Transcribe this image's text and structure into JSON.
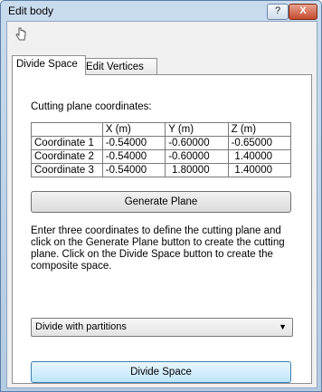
{
  "window": {
    "title": "Edit body",
    "help_label": "?",
    "close_label": "X"
  },
  "toolbar": {
    "icon": "cursor-hand-icon"
  },
  "tabs": [
    {
      "label": "Divide Space",
      "active": true
    },
    {
      "label": "Edit Vertices",
      "active": false
    }
  ],
  "panel": {
    "cutting_label": "Cutting plane coordinates:",
    "table": {
      "headers": [
        "",
        "X (m)",
        "Y (m)",
        "Z (m)"
      ],
      "rows": [
        {
          "label": "Coordinate 1",
          "x": "-0.54000",
          "y": "-0.60000",
          "z": "-0.65000"
        },
        {
          "label": "Coordinate 2",
          "x": "-0.54000",
          "y": "-0.60000",
          "z": "1.40000"
        },
        {
          "label": "Coordinate 3",
          "x": "-0.54000",
          "y": "1.80000",
          "z": "1.40000"
        }
      ]
    },
    "generate_button": "Generate Plane",
    "description": "Enter three coordinates to define the cutting plane and click on the Generate Plane button to create the cutting plane. Click on the Divide Space button to create the composite space.",
    "divide_select": {
      "selected": "Divide with partitions"
    },
    "divide_button": "Divide Space"
  }
}
